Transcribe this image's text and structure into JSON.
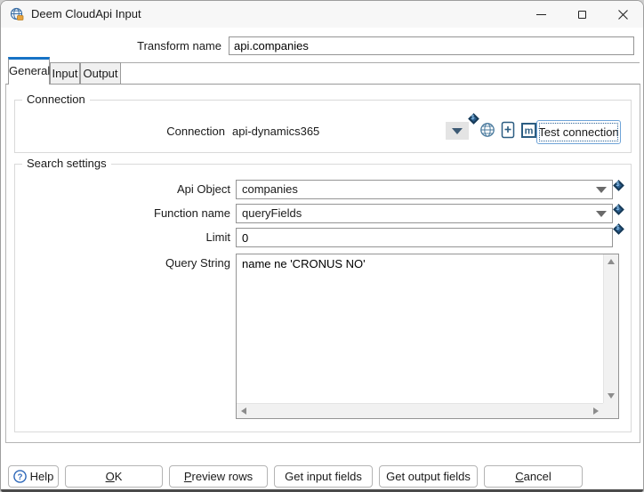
{
  "window": {
    "title": "Deem CloudApi Input",
    "controls": [
      {
        "name": "minimize-icon"
      },
      {
        "name": "maximize-icon"
      },
      {
        "name": "close-icon"
      }
    ]
  },
  "transform_name": {
    "label": "Transform name",
    "value": "api.companies"
  },
  "tabs": [
    {
      "label": "General",
      "selected": true
    },
    {
      "label": "Input",
      "selected": false
    },
    {
      "label": "Output",
      "selected": false
    }
  ],
  "connection": {
    "legend": "Connection",
    "row_label": "Connection",
    "value": "api-dynamics365",
    "icons": [
      {
        "name": "variable-dropdown-icon"
      },
      {
        "name": "globe-edit-connection-icon"
      },
      {
        "name": "new-connection-icon"
      },
      {
        "name": "metadata-explorer-icon"
      }
    ],
    "test_button": "Test connection"
  },
  "search": {
    "legend": "Search settings",
    "api_object": {
      "label": "Api Object",
      "value": "companies"
    },
    "function_name": {
      "label": "Function name",
      "value": "queryFields"
    },
    "limit": {
      "label": "Limit",
      "value": "0"
    },
    "query_string": {
      "label": "Query String",
      "value": "name ne 'CRONUS NO'"
    }
  },
  "variable_indicator": "$",
  "buttons": {
    "help": {
      "label": "Help"
    },
    "ok": {
      "mnemonic": "O",
      "rest": "K"
    },
    "preview_rows": {
      "mnemonic": "P",
      "rest": "review rows"
    },
    "get_input_fields": {
      "label": "Get input fields"
    },
    "get_output_fields": {
      "label": "Get output fields"
    },
    "cancel": {
      "mnemonic": "C",
      "rest": "ancel"
    }
  },
  "colors": {
    "accent_blue": "#1673c6",
    "icon_navy": "#2c5d82",
    "diamond_blue": "#2a5d8c",
    "titlebar_bg": "#f7f7f7",
    "tab_inactive_bg": "#f0f0f0",
    "border_grey": "#949494",
    "groupbox_border": "#d9d9d9",
    "scrollbar_track": "#f1f1f1",
    "help_icon_blue": "#2b66b8",
    "title_icon_orange": "#e8a33d"
  }
}
